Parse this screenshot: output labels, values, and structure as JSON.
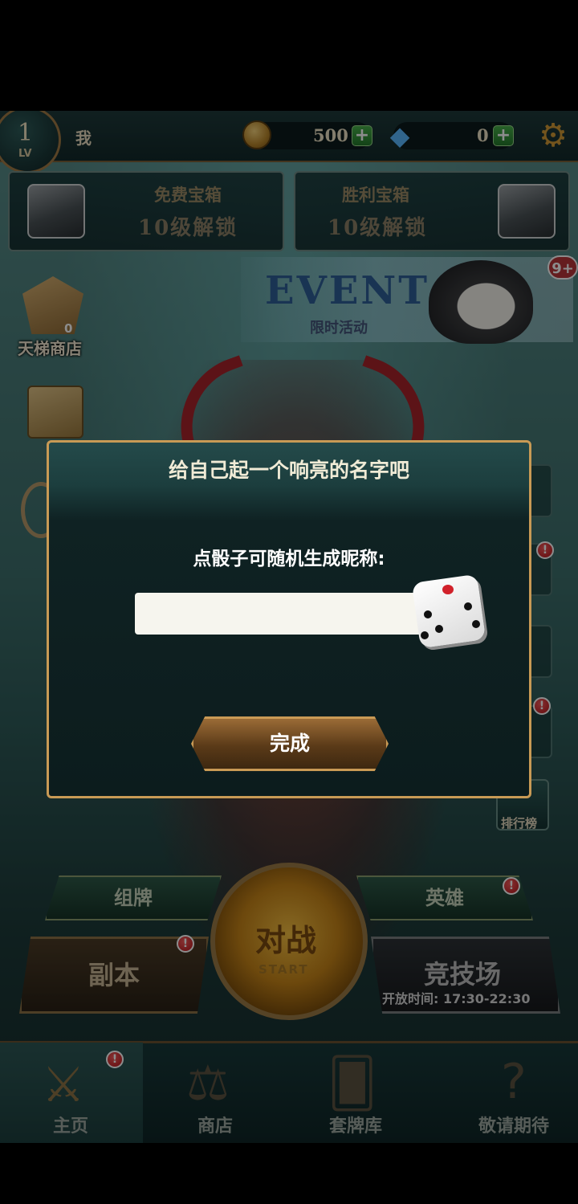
{
  "topbar": {
    "level": "1",
    "level_label": "LV",
    "player_name": "我",
    "coins": "500",
    "gems": "0",
    "plus": "+",
    "icons": {
      "coin": "coin-icon",
      "gem": "gem-icon",
      "settings": "gear-icon"
    }
  },
  "chests": [
    {
      "title": "免费宝箱",
      "subtitle": "10级解锁"
    },
    {
      "title": "胜利宝箱",
      "subtitle": "10级解锁"
    }
  ],
  "event": {
    "title": "EVENT",
    "subtitle": "限时活动",
    "badge": "9+"
  },
  "side": {
    "ladder_shop": "天梯商店",
    "ladder_count": "0",
    "ranking": "排行榜"
  },
  "buttons": {
    "deck": "组牌",
    "heroes": "英雄",
    "dungeon": "副本",
    "battle": "对战",
    "battle_sub": "START",
    "arena": "竞技场",
    "arena_time": "开放时间: 17:30-22:30",
    "alert": "!"
  },
  "nav": [
    {
      "label": "主页",
      "icon": "swords-icon"
    },
    {
      "label": "商店",
      "icon": "scales-icon"
    },
    {
      "label": "套牌库",
      "icon": "cards-icon"
    },
    {
      "label": "敬请期待",
      "icon": "question-icon"
    }
  ],
  "dialog": {
    "title": "给自己起一个响亮的名字吧",
    "prompt": "点骰子可随机生成昵称:",
    "input_value": "",
    "done": "完成",
    "dice_icon": "dice-icon"
  },
  "colors": {
    "accent_gold": "#c89a55",
    "alert_red": "#d1212a",
    "teal_bg": "#1c3e3e"
  }
}
